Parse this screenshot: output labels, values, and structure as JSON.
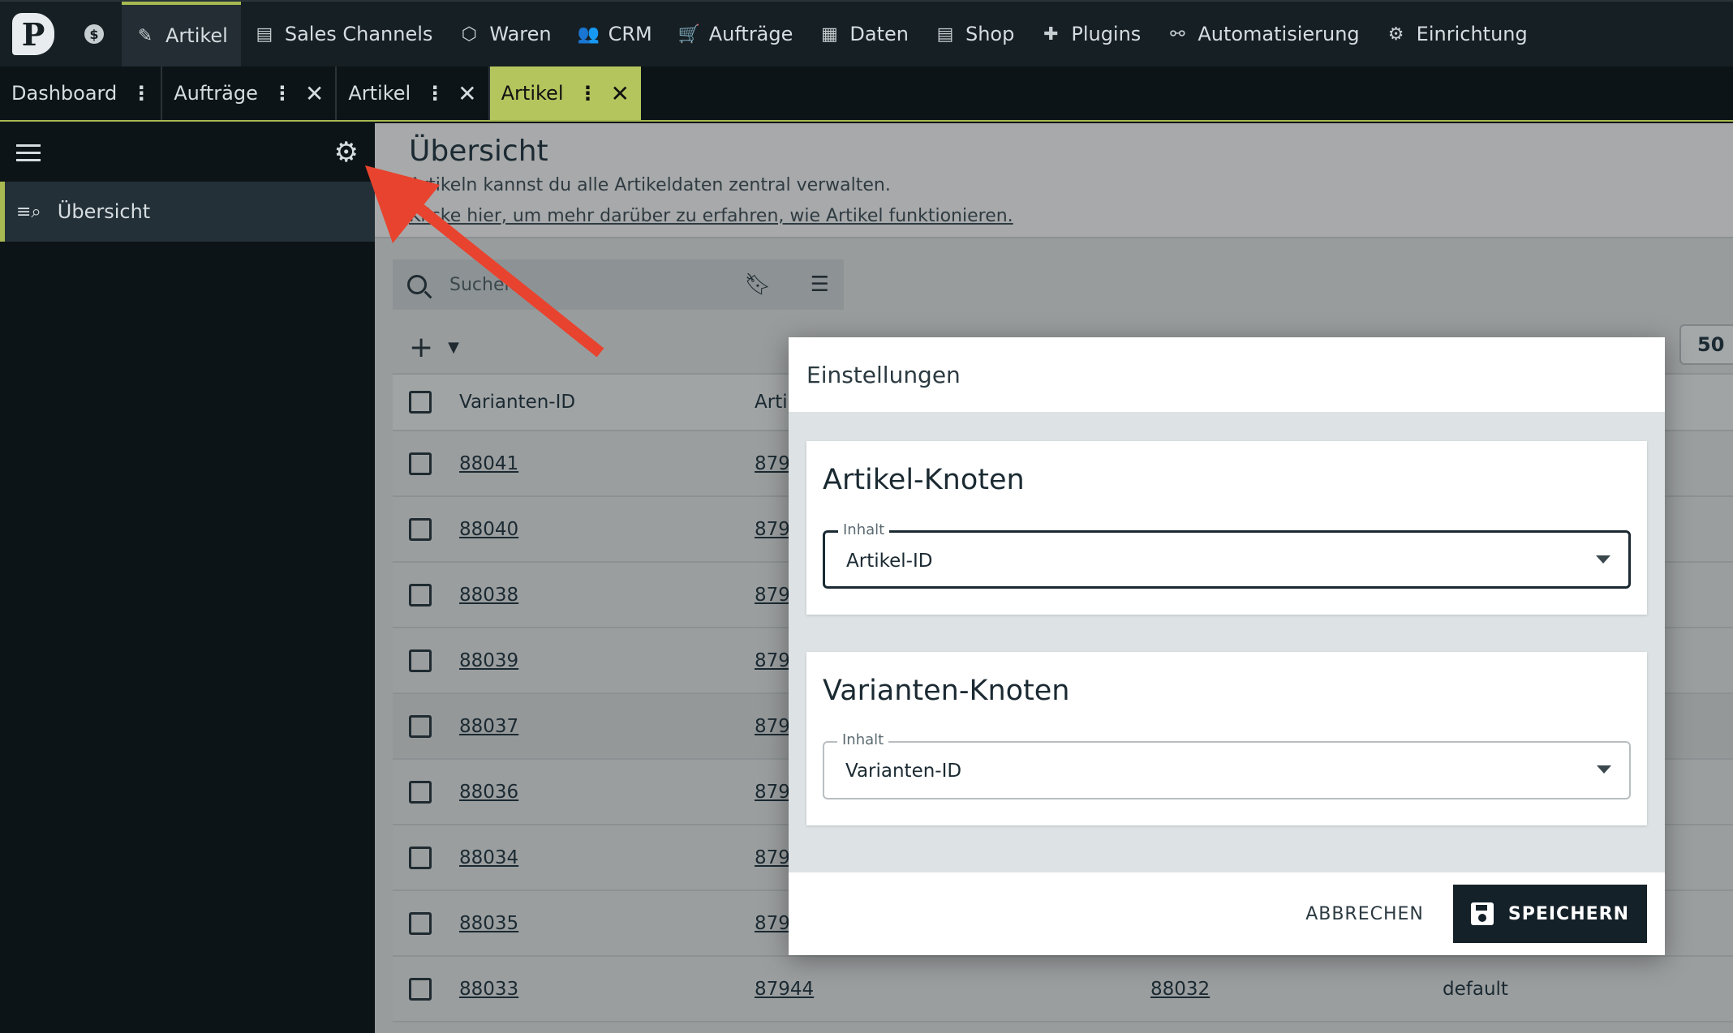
{
  "topnav": {
    "logo": "P",
    "dollar_icon": "$",
    "items": [
      {
        "label": "Artikel",
        "icon": "tag-icon",
        "glyph": "✎",
        "active": true
      },
      {
        "label": "Sales Channels",
        "icon": "store-icon",
        "glyph": "▤",
        "active": false
      },
      {
        "label": "Waren",
        "icon": "boxes-icon",
        "glyph": "⬡",
        "active": false
      },
      {
        "label": "CRM",
        "icon": "people-icon",
        "glyph": "👥",
        "active": false
      },
      {
        "label": "Aufträge",
        "icon": "cart-icon",
        "glyph": "🛒",
        "active": false
      },
      {
        "label": "Daten",
        "icon": "database-icon",
        "glyph": "▦",
        "active": false
      },
      {
        "label": "Shop",
        "icon": "shop-icon",
        "glyph": "▤",
        "active": false
      },
      {
        "label": "Plugins",
        "icon": "puzzle-icon",
        "glyph": "✚",
        "active": false
      },
      {
        "label": "Automatisierung",
        "icon": "flow-icon",
        "glyph": "⚯",
        "active": false
      },
      {
        "label": "Einrichtung",
        "icon": "gear-icon",
        "glyph": "⚙",
        "active": false
      }
    ]
  },
  "tabs": [
    {
      "label": "Dashboard",
      "closable": false,
      "active": false
    },
    {
      "label": "Aufträge",
      "closable": true,
      "active": false
    },
    {
      "label": "Artikel",
      "closable": true,
      "active": false
    },
    {
      "label": "Artikel",
      "closable": true,
      "active": true
    }
  ],
  "sidebar": {
    "items": [
      {
        "label": "Übersicht",
        "icon": "list-search-icon"
      }
    ]
  },
  "overview": {
    "title": "Übersicht",
    "description": "Artikeln kannst du alle Artikeldaten zentral verwalten.",
    "link": "Klicke hier, um mehr darüber zu erfahren, wie Artikel funktionieren."
  },
  "search": {
    "placeholder": "Suchen"
  },
  "pagination": {
    "per_page": "50"
  },
  "table": {
    "headers": [
      "Varianten-ID",
      "Arti",
      "",
      ""
    ],
    "rows": [
      {
        "variant_id": "88041",
        "article_id": "879",
        "col3": "",
        "col4": ""
      },
      {
        "variant_id": "88040",
        "article_id": "879",
        "col3": "",
        "col4": ""
      },
      {
        "variant_id": "88038",
        "article_id": "879",
        "col3": "",
        "col4": ""
      },
      {
        "variant_id": "88039",
        "article_id": "879",
        "col3": "",
        "col4": ""
      },
      {
        "variant_id": "88037",
        "article_id": "879",
        "col3": "",
        "col4": ""
      },
      {
        "variant_id": "88036",
        "article_id": "879",
        "col3": "",
        "col4": ""
      },
      {
        "variant_id": "88034",
        "article_id": "879",
        "col3": "",
        "col4": ""
      },
      {
        "variant_id": "88035",
        "article_id": "879",
        "col3": "",
        "col4": ""
      },
      {
        "variant_id": "88033",
        "article_id": "87944",
        "col3": "88032",
        "col4": "default"
      }
    ]
  },
  "modal": {
    "title": "Einstellungen",
    "section1": {
      "title": "Artikel-Knoten",
      "label": "Inhalt",
      "value": "Artikel-ID"
    },
    "section2": {
      "title": "Varianten-Knoten",
      "label": "Inhalt",
      "value": "Varianten-ID"
    },
    "cancel_label": "ABBRECHEN",
    "save_label": "SPEICHERN"
  },
  "colors": {
    "accent": "#b4c55d",
    "nav_bg": "#161f24",
    "annotation_arrow": "#e8432e",
    "save_button": "#152129"
  }
}
